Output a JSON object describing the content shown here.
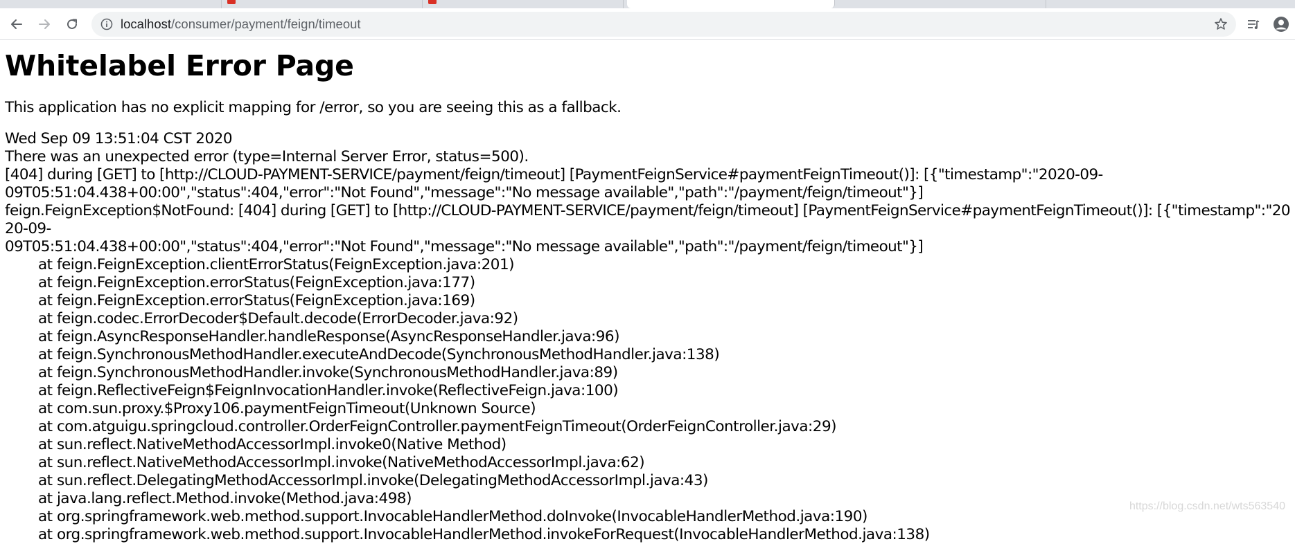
{
  "browser": {
    "url_host": "localhost",
    "url_path": "/consumer/payment/feign/timeout"
  },
  "page": {
    "title": "Whitelabel Error Page",
    "intro": "This application has no explicit mapping for /error, so you are seeing this as a fallback.",
    "timestamp": "Wed Sep 09 13:51:04 CST 2020",
    "summary": "There was an unexpected error (type=Internal Server Error, status=500).",
    "message_line1": "[404] during [GET] to [http://CLOUD-PAYMENT-SERVICE/payment/feign/timeout] [PaymentFeignService#paymentFeignTimeout()]: [{\"timestamp\":\"2020-09-",
    "message_line2": "09T05:51:04.438+00:00\",\"status\":404,\"error\":\"Not Found\",\"message\":\"No message available\",\"path\":\"/payment/feign/timeout\"}]",
    "exception_line1": "feign.FeignException$NotFound: [404] during [GET] to [http://CLOUD-PAYMENT-SERVICE/payment/feign/timeout] [PaymentFeignService#paymentFeignTimeout()]: [{\"timestamp\":\"2020-09-",
    "exception_line2": "09T05:51:04.438+00:00\",\"status\":404,\"error\":\"Not Found\",\"message\":\"No message available\",\"path\":\"/payment/feign/timeout\"}]",
    "frames": [
      "at feign.FeignException.clientErrorStatus(FeignException.java:201)",
      "at feign.FeignException.errorStatus(FeignException.java:177)",
      "at feign.FeignException.errorStatus(FeignException.java:169)",
      "at feign.codec.ErrorDecoder$Default.decode(ErrorDecoder.java:92)",
      "at feign.AsyncResponseHandler.handleResponse(AsyncResponseHandler.java:96)",
      "at feign.SynchronousMethodHandler.executeAndDecode(SynchronousMethodHandler.java:138)",
      "at feign.SynchronousMethodHandler.invoke(SynchronousMethodHandler.java:89)",
      "at feign.ReflectiveFeign$FeignInvocationHandler.invoke(ReflectiveFeign.java:100)",
      "at com.sun.proxy.$Proxy106.paymentFeignTimeout(Unknown Source)",
      "at com.atguigu.springcloud.controller.OrderFeignController.paymentFeignTimeout(OrderFeignController.java:29)",
      "at sun.reflect.NativeMethodAccessorImpl.invoke0(Native Method)",
      "at sun.reflect.NativeMethodAccessorImpl.invoke(NativeMethodAccessorImpl.java:62)",
      "at sun.reflect.DelegatingMethodAccessorImpl.invoke(DelegatingMethodAccessorImpl.java:43)",
      "at java.lang.reflect.Method.invoke(Method.java:498)",
      "at org.springframework.web.method.support.InvocableHandlerMethod.doInvoke(InvocableHandlerMethod.java:190)",
      "at org.springframework.web.method.support.InvocableHandlerMethod.invokeForRequest(InvocableHandlerMethod.java:138)"
    ]
  },
  "watermark": "https://blog.csdn.net/wts563540",
  "icons": {
    "back": "back-arrow-icon",
    "forward": "forward-arrow-icon",
    "reload": "reload-icon",
    "info": "info-icon",
    "bookmark": "star-icon",
    "media": "playlist-icon",
    "profile": "profile-icon"
  },
  "colors": {
    "tabstrip": "#dee1e6",
    "omnibox": "#f1f3f4",
    "favicon": "#d93025"
  }
}
